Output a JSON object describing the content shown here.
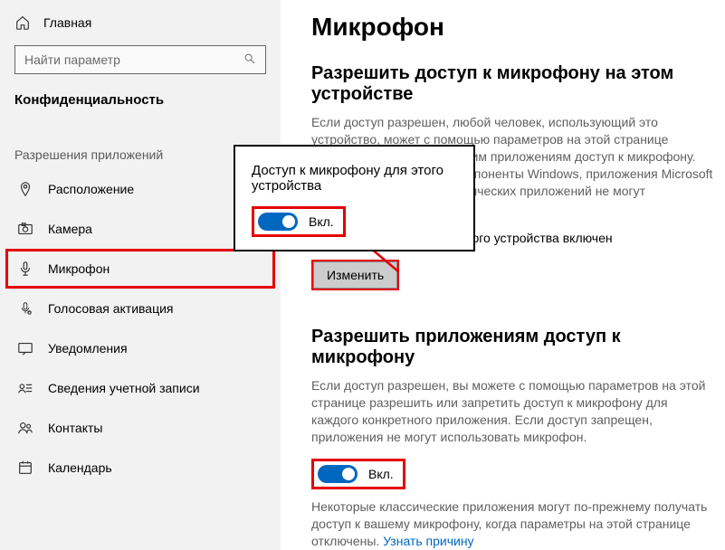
{
  "sidebar": {
    "home_label": "Главная",
    "search_placeholder": "Найти параметр",
    "group_title": "Конфиденциальность",
    "section_title": "Разрешения приложений",
    "items": [
      {
        "label": "Расположение"
      },
      {
        "label": "Камера"
      },
      {
        "label": "Микрофон"
      },
      {
        "label": "Голосовая активация"
      },
      {
        "label": "Уведомления"
      },
      {
        "label": "Сведения учетной записи"
      },
      {
        "label": "Контакты"
      },
      {
        "label": "Календарь"
      }
    ]
  },
  "main": {
    "title": "Микрофон",
    "section1": {
      "heading": "Разрешить доступ к микрофону на этом устройстве",
      "body": "Если доступ разрешен, любой человек, использующий это устройство, может с помощью параметров на этой странице разрешить и запретить своим приложениям доступ к микрофону. Если доступ запрещен, компоненты Windows, приложения Microsoft Store и большинство классических приложений не могут использовать микрофон.",
      "status": "Доступ к микрофону для этого устройства включен",
      "change_label": "Изменить"
    },
    "section2": {
      "heading": "Разрешить приложениям доступ к микрофону",
      "body": "Если доступ разрешен, вы можете с помощью параметров на этой странице разрешить или запретить доступ к микрофону для каждого конкретного приложения. Если доступ запрещен, приложения не могут использовать микрофон.",
      "toggle_label": "Вкл.",
      "note_prefix": "Некоторые классические приложения могут по-прежнему получать доступ к вашему микрофону, когда параметры на этой странице отключены. ",
      "note_link": "Узнать причину"
    }
  },
  "popup": {
    "title": "Доступ к микрофону для этого устройства",
    "toggle_label": "Вкл."
  }
}
